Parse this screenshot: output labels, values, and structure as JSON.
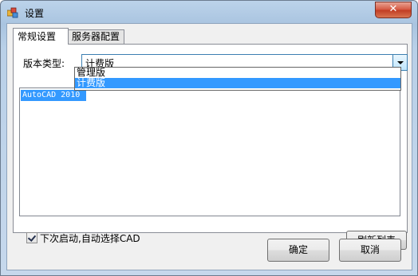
{
  "window": {
    "title": "设置",
    "close_label": "✕"
  },
  "tabs": [
    {
      "label": "常规设置",
      "active": true
    },
    {
      "label": "服务器配置",
      "active": false
    }
  ],
  "general": {
    "version_label": "版本类型:",
    "version_value": "计费版",
    "version_options": [
      "管理版",
      "计费版"
    ],
    "version_selected_index": 1,
    "cad_list": [
      "AutoCAD 2010"
    ],
    "auto_select_label": "下次启动,自动选择CAD",
    "auto_select_checked": true,
    "refresh_label": "刷新列表"
  },
  "buttons": {
    "ok": "确定",
    "cancel": "取消"
  },
  "colors": {
    "selection": "#3399ff",
    "close_button": "#c8442a",
    "title_bar": "#b9d0e8"
  }
}
